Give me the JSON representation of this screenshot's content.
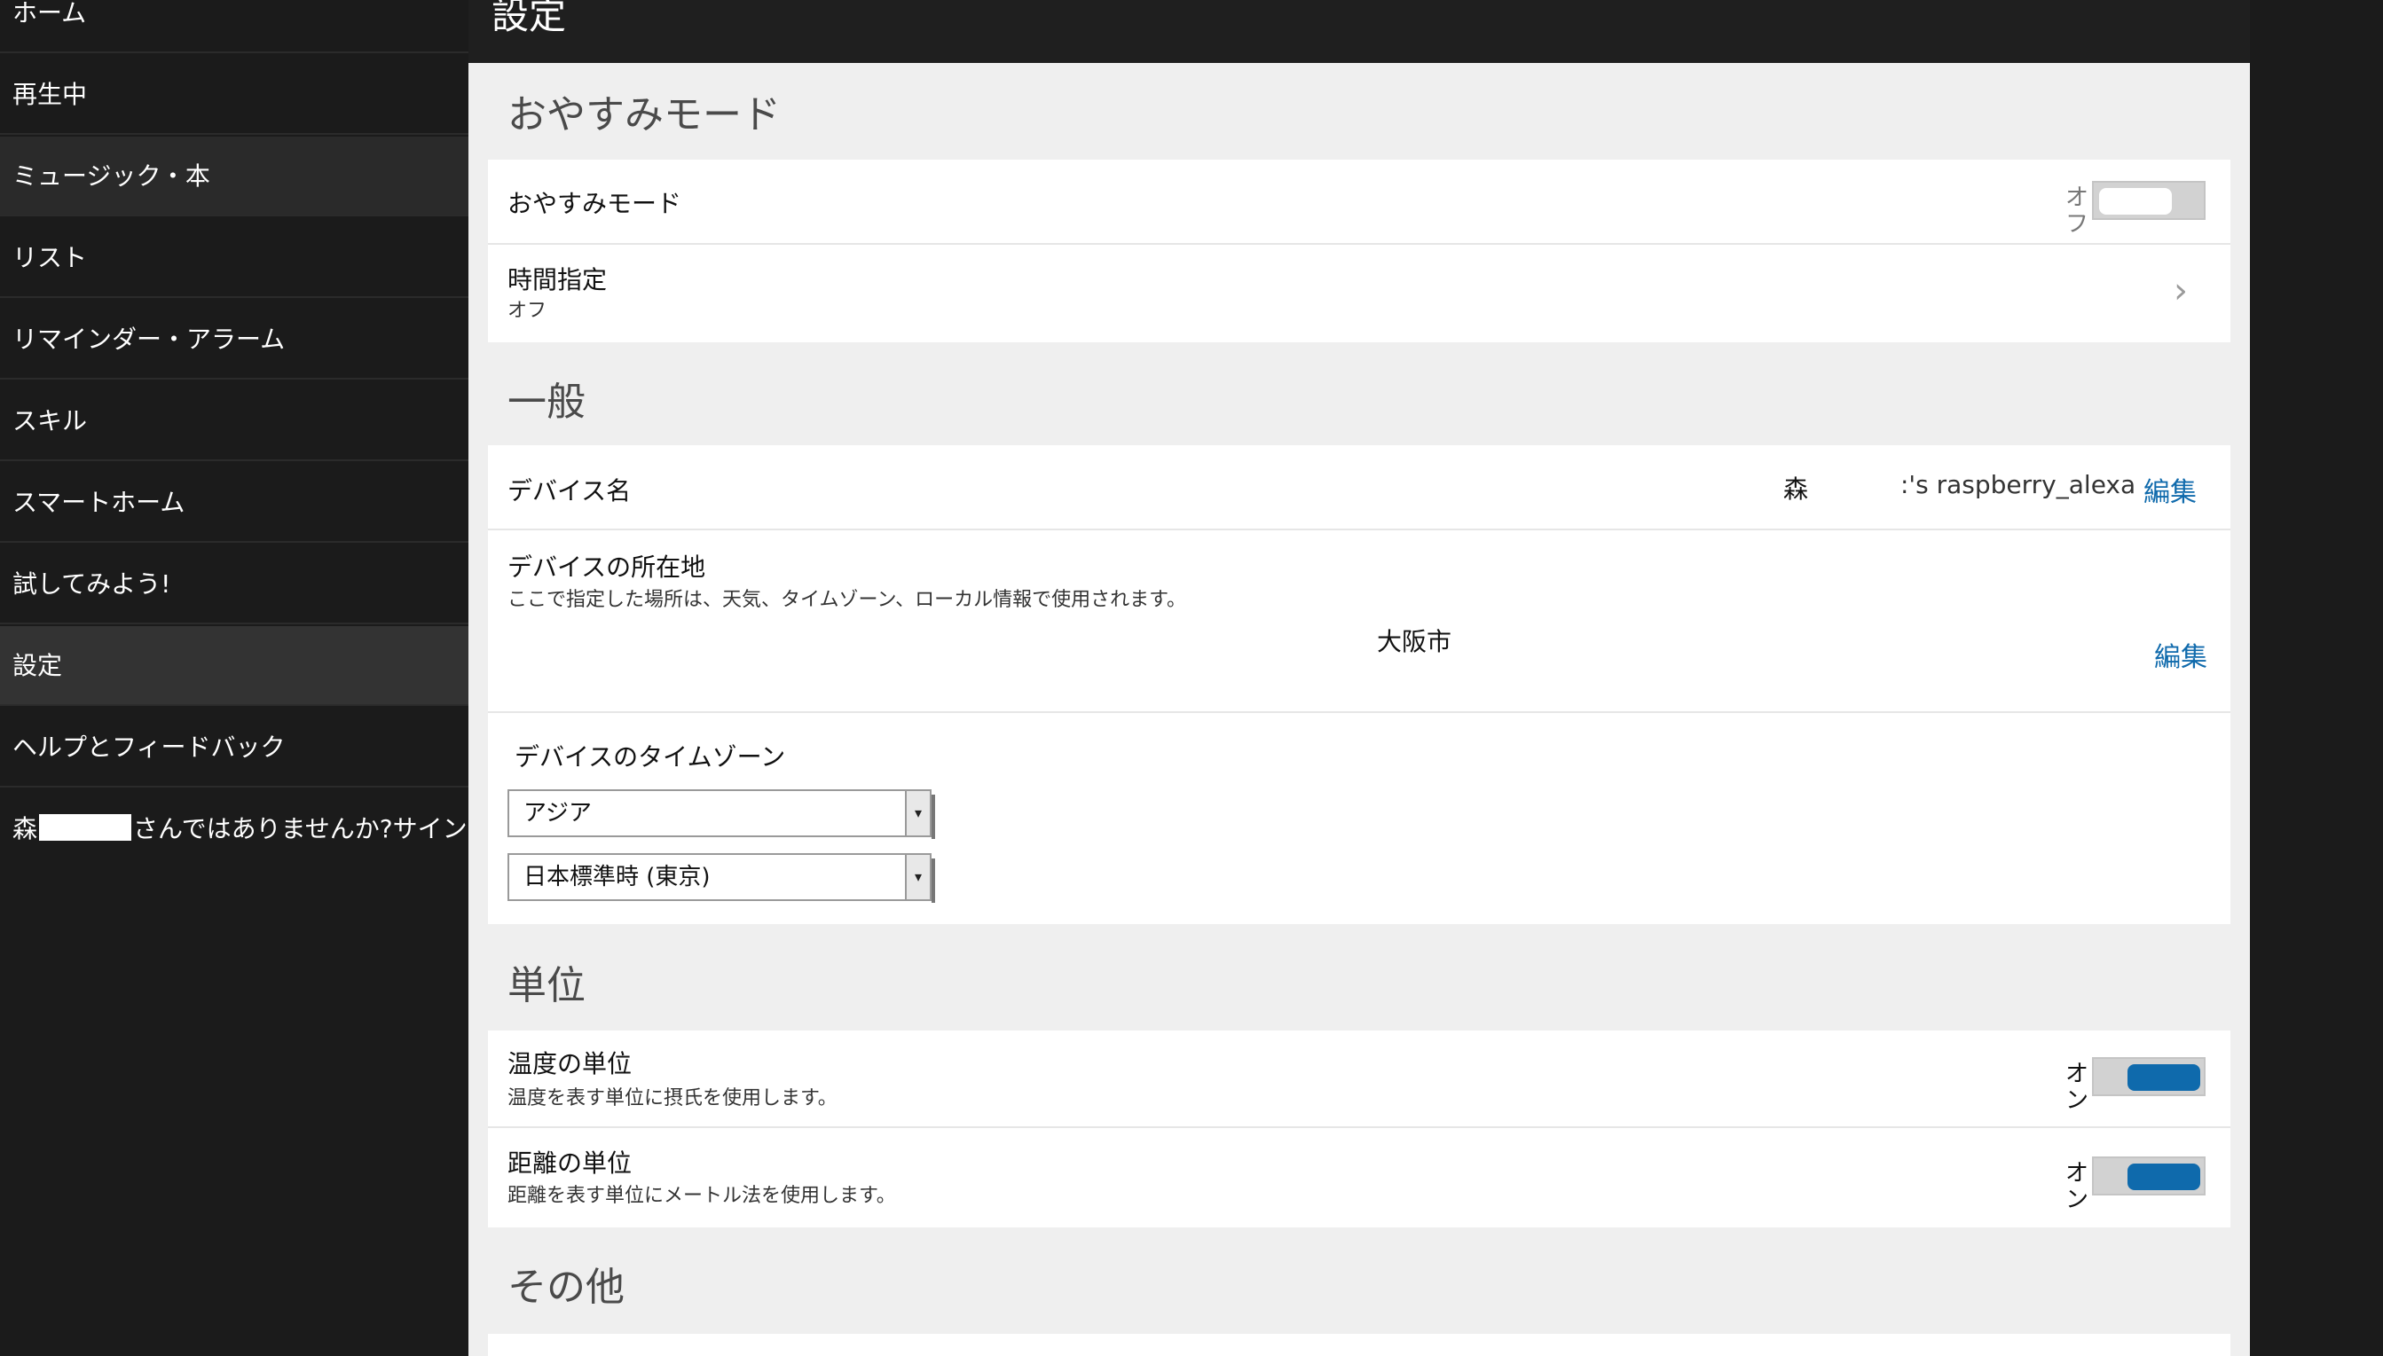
{
  "sidebar": {
    "items": [
      {
        "label": "ホーム"
      },
      {
        "label": "再生中"
      },
      {
        "label": "ミュージック・本"
      },
      {
        "label": "リスト"
      },
      {
        "label": "リマインダー・アラーム"
      },
      {
        "label": "スキル"
      },
      {
        "label": "スマートホーム"
      },
      {
        "label": "試してみよう!"
      },
      {
        "label": "設定"
      },
      {
        "label": "ヘルプとフィードバック"
      }
    ],
    "account_prefix": "森",
    "account_suffix": "さんではありませんか?サイン"
  },
  "header": {
    "title": "設定"
  },
  "dnd": {
    "section_title": "おやすみモード",
    "toggle_label": "おやすみモード",
    "toggle_state_text": "オフ",
    "toggle_on": false,
    "schedule_label": "時間指定",
    "schedule_value": "オフ"
  },
  "general": {
    "section_title": "一般",
    "device_name_label": "デバイス名",
    "device_name_prefix": "森",
    "device_name_suffix": ":'s raspberry_alexa",
    "edit_label": "編集",
    "location_label": "デバイスの所在地",
    "location_desc": "ここで指定した場所は、天気、タイムゾーン、ローカル情報で使用されます。",
    "location_value": "大阪市",
    "location_edit_label": "編集",
    "timezone_label": "デバイスのタイムゾーン",
    "region_select": "アジア",
    "zone_select": "日本標準時 (東京)"
  },
  "units": {
    "section_title": "単位",
    "temperature_label": "温度の単位",
    "temperature_desc": "温度を表す単位に摂氏を使用します。",
    "temperature_state_text": "オン",
    "temperature_on": true,
    "distance_label": "距離の単位",
    "distance_desc": "距離を表す単位にメートル法を使用します。",
    "distance_state_text": "オン",
    "distance_on": true
  },
  "other": {
    "section_title": "その他"
  },
  "colors": {
    "accent": "#0f6aac",
    "sidebar_bg": "#1b1b1b",
    "panel_bg": "#efefef"
  }
}
